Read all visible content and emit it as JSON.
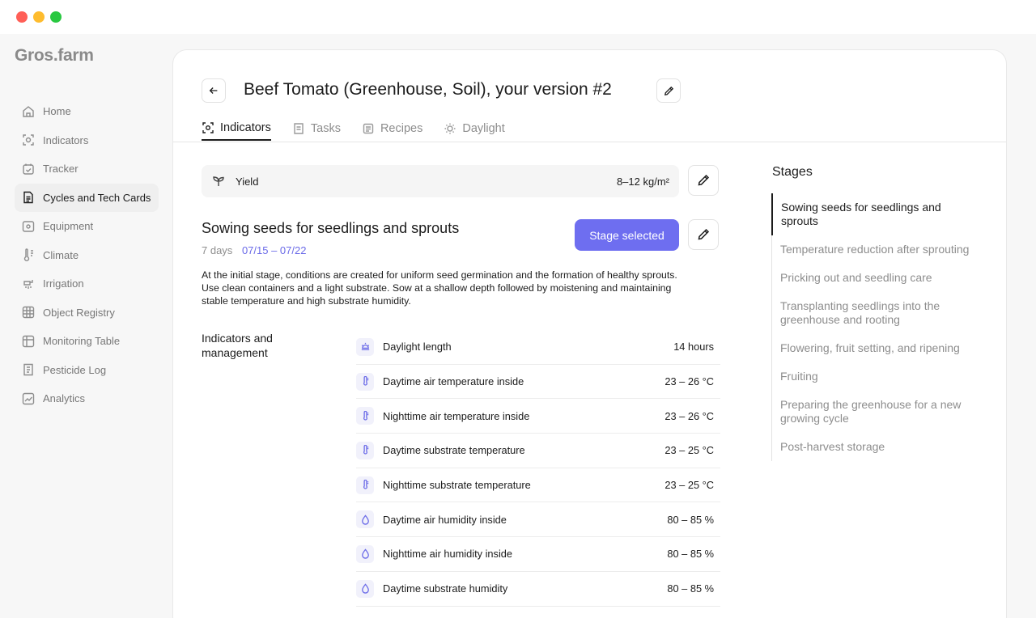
{
  "app": {
    "logo": "Gros.farm"
  },
  "sidebar": {
    "items": [
      {
        "label": "Home",
        "icon": "home-icon"
      },
      {
        "label": "Indicators",
        "icon": "indicators-icon"
      },
      {
        "label": "Tracker",
        "icon": "tracker-icon"
      },
      {
        "label": "Cycles and Tech Cards",
        "icon": "document-icon",
        "active": true
      },
      {
        "label": "Equipment",
        "icon": "equipment-icon"
      },
      {
        "label": "Climate",
        "icon": "climate-icon"
      },
      {
        "label": "Irrigation",
        "icon": "irrigation-icon"
      },
      {
        "label": "Object Registry",
        "icon": "grid-icon"
      },
      {
        "label": "Monitoring Table",
        "icon": "table-icon"
      },
      {
        "label": "Pesticide Log",
        "icon": "log-icon"
      },
      {
        "label": "Analytics",
        "icon": "analytics-icon"
      }
    ]
  },
  "header": {
    "title": "Beef Tomato (Greenhouse, Soil), your version #2"
  },
  "tabs": [
    {
      "label": "Indicators",
      "icon": "indicators-icon",
      "active": true
    },
    {
      "label": "Tasks",
      "icon": "tasks-icon"
    },
    {
      "label": "Recipes",
      "icon": "recipes-icon"
    },
    {
      "label": "Daylight",
      "icon": "sun-icon"
    }
  ],
  "yield": {
    "label": "Yield",
    "value": "8–12 kg/m²"
  },
  "stage": {
    "title": "Sowing seeds for seedlings and sprouts",
    "duration": "7 days",
    "dates": "07/15 – 07/22",
    "button": "Stage selected",
    "description": "At the initial stage, conditions are created for uniform seed germination and the formation of healthy sprouts. Use clean containers and a light substrate. Sow at a shallow depth followed by moistening and maintaining stable temperature and high substrate humidity."
  },
  "indicators": {
    "label": "Indicators and management",
    "rows": [
      {
        "name": "Daylight length",
        "value": "14 hours",
        "icon": "sun-icon"
      },
      {
        "name": "Daytime air temperature inside",
        "value": "23 – 26 °C",
        "icon": "thermometer-icon"
      },
      {
        "name": "Nighttime air temperature inside",
        "value": "23 – 26 °C",
        "icon": "thermometer-icon"
      },
      {
        "name": "Daytime substrate temperature",
        "value": "23 – 25 °C",
        "icon": "thermometer-icon"
      },
      {
        "name": "Nighttime substrate temperature",
        "value": "23 – 25 °C",
        "icon": "thermometer-icon"
      },
      {
        "name": "Daytime air humidity inside",
        "value": "80 – 85 %",
        "icon": "drop-icon"
      },
      {
        "name": "Nighttime air humidity inside",
        "value": "80 – 85 %",
        "icon": "drop-icon"
      },
      {
        "name": "Daytime substrate humidity",
        "value": "80 – 85 %",
        "icon": "drop-icon"
      }
    ]
  },
  "stages": {
    "heading": "Stages",
    "items": [
      {
        "label": "Sowing seeds for seedlings and sprouts",
        "active": true
      },
      {
        "label": "Temperature reduction after sprouting"
      },
      {
        "label": "Pricking out and seedling care"
      },
      {
        "label": "Transplanting seedlings into the greenhouse and rooting"
      },
      {
        "label": "Flowering, fruit setting, and ripening"
      },
      {
        "label": "Fruiting"
      },
      {
        "label": "Preparing the greenhouse for a new growing cycle"
      },
      {
        "label": "Post-harvest storage"
      }
    ]
  },
  "colors": {
    "accent": "#6e6ef0",
    "accent_text": "#6b6be8"
  }
}
